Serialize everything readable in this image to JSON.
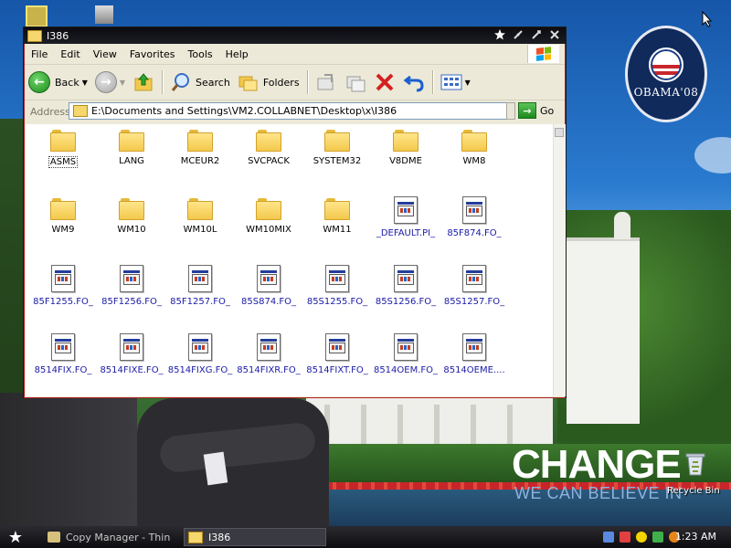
{
  "window": {
    "title": "I386",
    "menu": [
      "File",
      "Edit",
      "View",
      "Favorites",
      "Tools",
      "Help"
    ],
    "toolbar": {
      "back_label": "Back",
      "search_label": "Search",
      "folders_label": "Folders"
    },
    "address": {
      "label": "Address",
      "value": "E:\\Documents and Settings\\VM2.COLLABNET\\Desktop\\x\\I386",
      "go_label": "Go"
    },
    "items": [
      {
        "name": "ASMS",
        "type": "folder"
      },
      {
        "name": "LANG",
        "type": "folder"
      },
      {
        "name": "MCEUR2",
        "type": "folder"
      },
      {
        "name": "SVCPACK",
        "type": "folder"
      },
      {
        "name": "SYSTEM32",
        "type": "folder"
      },
      {
        "name": "V8DME",
        "type": "folder"
      },
      {
        "name": "WM8",
        "type": "folder"
      },
      {
        "name": "WM9",
        "type": "folder"
      },
      {
        "name": "WM10",
        "type": "folder"
      },
      {
        "name": "WM10L",
        "type": "folder"
      },
      {
        "name": "WM10MIX",
        "type": "folder"
      },
      {
        "name": "WM11",
        "type": "folder"
      },
      {
        "name": "_DEFAULT.PI_",
        "type": "file"
      },
      {
        "name": "85F874.FO_",
        "type": "file"
      },
      {
        "name": "85F1255.FO_",
        "type": "file"
      },
      {
        "name": "85F1256.FO_",
        "type": "file"
      },
      {
        "name": "85F1257.FO_",
        "type": "file"
      },
      {
        "name": "85S874.FO_",
        "type": "file"
      },
      {
        "name": "85S1255.FO_",
        "type": "file"
      },
      {
        "name": "85S1256.FO_",
        "type": "file"
      },
      {
        "name": "85S1257.FO_",
        "type": "file"
      },
      {
        "name": "8514FIX.FO_",
        "type": "file"
      },
      {
        "name": "8514FIXE.FO_",
        "type": "file"
      },
      {
        "name": "8514FIXG.FO_",
        "type": "file"
      },
      {
        "name": "8514FIXR.FO_",
        "type": "file"
      },
      {
        "name": "8514FIXT.FO_",
        "type": "file"
      },
      {
        "name": "8514OEM.FO_",
        "type": "file"
      },
      {
        "name": "8514OEME....",
        "type": "file"
      }
    ]
  },
  "desktop": {
    "obama_logo_text": "OBAMA'08",
    "change_text": "CHANGE",
    "change_sub": "WE CAN BELIEVE IN",
    "recycle_label": "Recycle Bin"
  },
  "taskbar": {
    "tasks": [
      "Copy Manager - Thin",
      "I386"
    ],
    "clock": "1:23 AM"
  },
  "colors": {
    "folder": "#f3c94c",
    "file_label": "#1a1aa8",
    "window_border": "#b02020",
    "titlebar": "#0b0b10"
  }
}
